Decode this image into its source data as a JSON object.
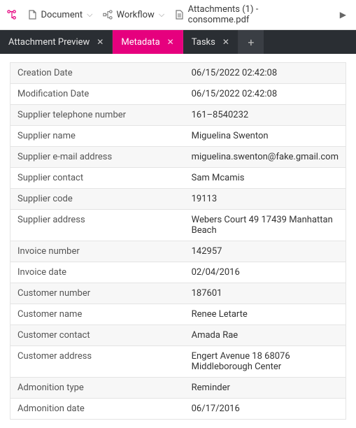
{
  "toolbar": {
    "tree_icon": "tree-icon",
    "items": [
      {
        "label": "Document",
        "icon": "document-icon"
      },
      {
        "label": "Workflow",
        "icon": "workflow-icon"
      },
      {
        "label": "Attachments (1) - consomme.pdf",
        "icon": "attachments-icon",
        "no_chevron": true
      }
    ]
  },
  "tabs": {
    "items": [
      {
        "label": "Attachment Preview",
        "active": false
      },
      {
        "label": "Metadata",
        "active": true
      },
      {
        "label": "Tasks",
        "active": false
      }
    ]
  },
  "metadata": {
    "rows": [
      {
        "key": "Creation Date",
        "value": "06/15/2022 02:42:08"
      },
      {
        "key": "Modification Date",
        "value": "06/15/2022 02:42:08"
      },
      {
        "key": "Supplier telephone number",
        "value": "161–8540232"
      },
      {
        "key": "Supplier name",
        "value": "Miguelina Swenton"
      },
      {
        "key": "Supplier e-mail address",
        "value": "miguelina.swenton@fake.gmail.com"
      },
      {
        "key": "Supplier contact",
        "value": "Sam Mcamis"
      },
      {
        "key": "Supplier code",
        "value": "19113"
      },
      {
        "key": "Supplier address",
        "value": "Webers Court 49 17439 Manhattan Beach"
      },
      {
        "key": "Invoice number",
        "value": "142957"
      },
      {
        "key": "Invoice date",
        "value": "02/04/2016"
      },
      {
        "key": "Customer number",
        "value": "187601"
      },
      {
        "key": "Customer name",
        "value": "Renee Letarte"
      },
      {
        "key": "Customer contact",
        "value": "Amada Rae"
      },
      {
        "key": "Customer address",
        "value": "Engert Avenue 18 68076 Middleborough Center"
      },
      {
        "key": "Admonition type",
        "value": "Reminder"
      },
      {
        "key": "Admonition date",
        "value": "06/17/2016"
      }
    ]
  }
}
